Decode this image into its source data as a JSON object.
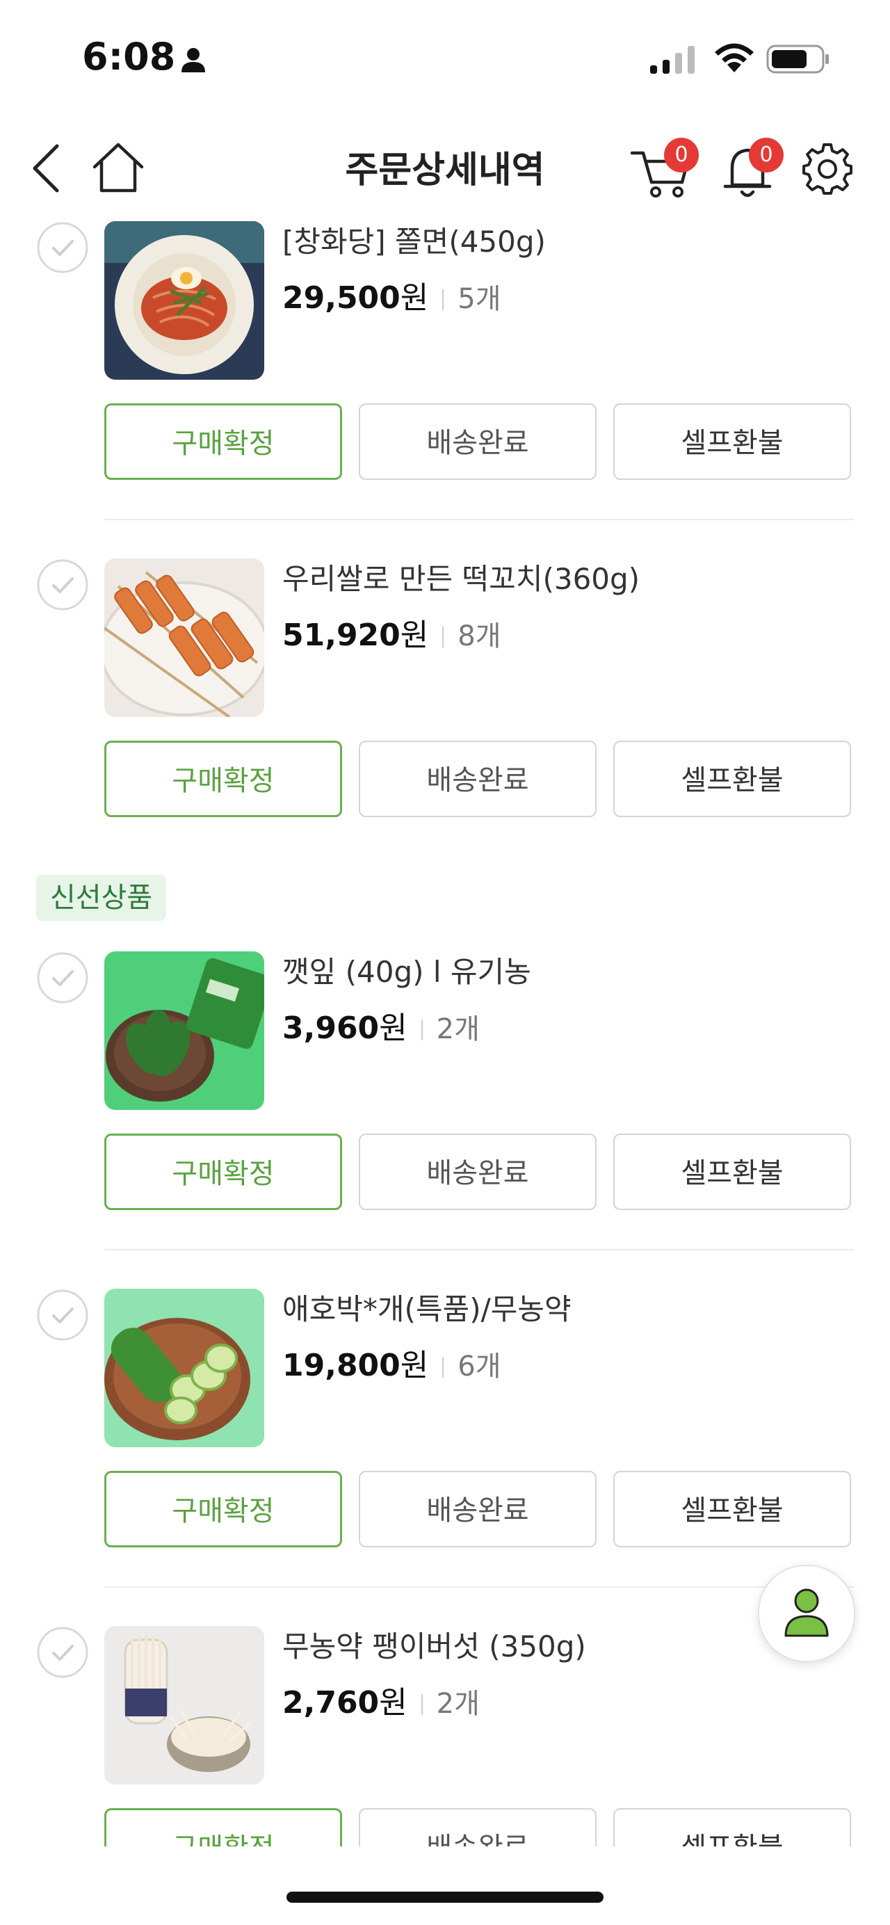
{
  "status_bar": {
    "time": "6:08"
  },
  "nav": {
    "title": "주문상세내역",
    "cart_badge": "0",
    "bell_badge": "0"
  },
  "items": [
    {
      "name": "[창화당] 쫄면(450g)",
      "price": "29,500",
      "won": "원",
      "qty": "5개",
      "thumb": "bowl-of-noodles-image"
    },
    {
      "name": "우리쌀로 만든 떡꼬치(360g)",
      "price": "51,920",
      "won": "원",
      "qty": "8개",
      "thumb": "rice-cake-skewers-image"
    },
    {
      "name": "깻잎 (40g) l 유기농",
      "price": "3,960",
      "won": "원",
      "qty": "2개",
      "thumb": "perilla-leaves-image"
    },
    {
      "name": "애호박*개(특품)/무농약",
      "price": "19,800",
      "won": "원",
      "qty": "6개",
      "thumb": "zucchini-image"
    },
    {
      "name": "무농약 팽이버섯 (350g)",
      "price": "2,760",
      "won": "원",
      "qty": "2개",
      "thumb": "enoki-mushroom-image"
    }
  ],
  "buttons": {
    "confirm": "구매확정",
    "delivered": "배송완료",
    "refund": "셀프환불"
  },
  "category_tag": "신선상품",
  "colors": {
    "accent": "#5aa23f",
    "badge": "#e53935",
    "tag_bg": "#e6f5e8"
  }
}
